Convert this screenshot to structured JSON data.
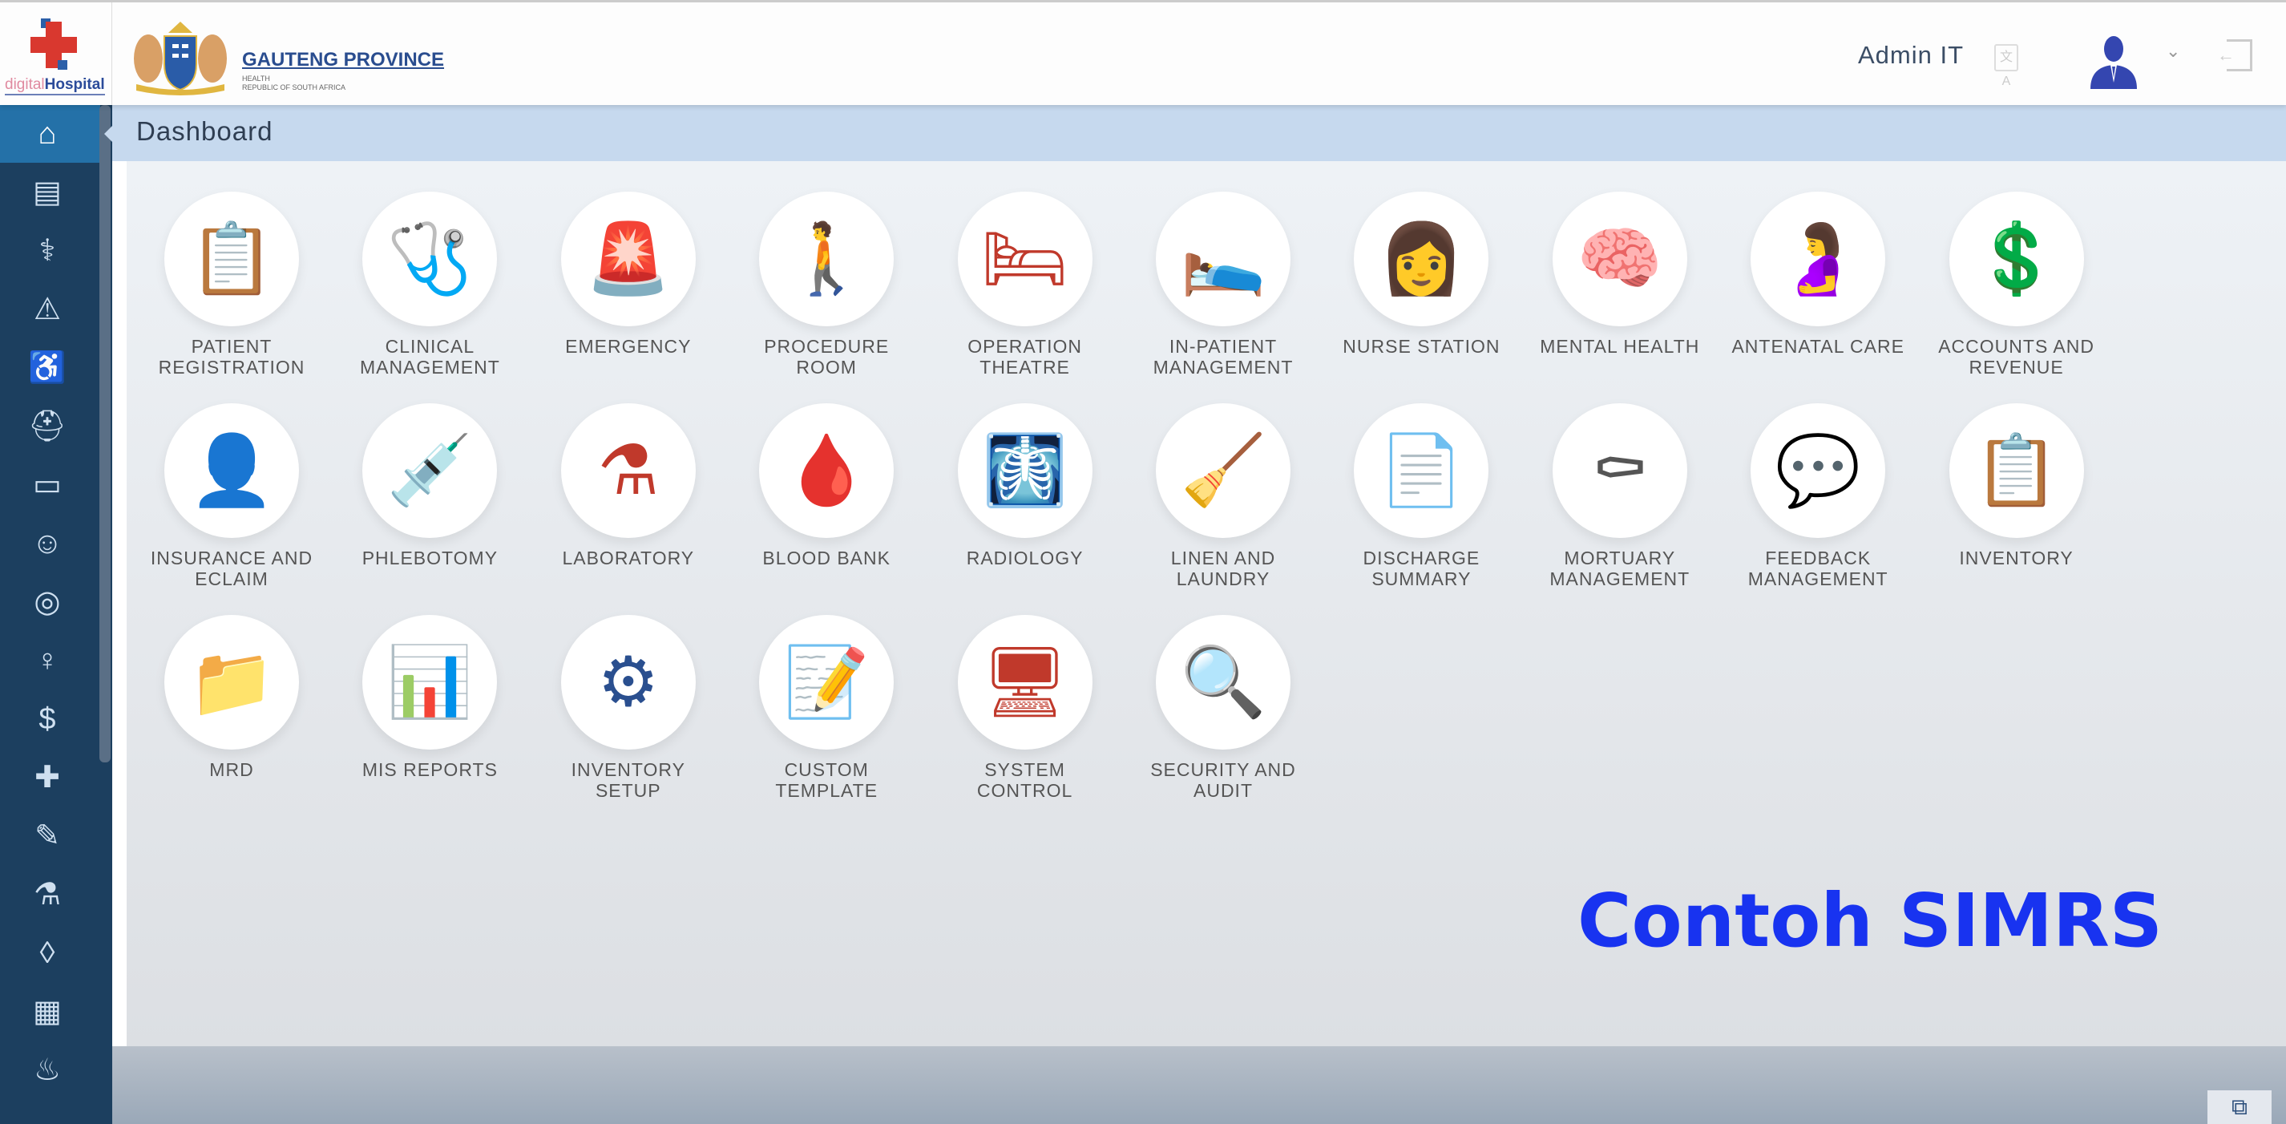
{
  "header": {
    "brand_logo": "digitalHospital",
    "province": "GAUTENG PROVINCE",
    "province_sub1": "HEALTH",
    "province_sub2": "REPUBLIC OF SOUTH AFRICA",
    "user_name": "Admin IT",
    "avatar_color": "#3446b0"
  },
  "breadcrumb": {
    "title": "Dashboard"
  },
  "sidebar": {
    "items": [
      {
        "icon": "home-icon",
        "glyph": "⌂"
      },
      {
        "icon": "clipboard-icon",
        "glyph": "▤"
      },
      {
        "icon": "clinical-icon",
        "glyph": "⚕"
      },
      {
        "icon": "siren-icon",
        "glyph": "⚠"
      },
      {
        "icon": "procedure-icon",
        "glyph": "♿"
      },
      {
        "icon": "operation-icon",
        "glyph": "⛑"
      },
      {
        "icon": "bed-icon",
        "glyph": "▭"
      },
      {
        "icon": "nurse-icon",
        "glyph": "☺"
      },
      {
        "icon": "brain-icon",
        "glyph": "◎"
      },
      {
        "icon": "antenatal-icon",
        "glyph": "♀"
      },
      {
        "icon": "accounts-icon",
        "glyph": "$"
      },
      {
        "icon": "insurance-icon",
        "glyph": "✚"
      },
      {
        "icon": "syringe-icon",
        "glyph": "✎"
      },
      {
        "icon": "flask-icon",
        "glyph": "⚗"
      },
      {
        "icon": "blood-drop-icon",
        "glyph": "◊"
      },
      {
        "icon": "radiology-icon",
        "glyph": "▦"
      },
      {
        "icon": "laundry-icon",
        "glyph": "♨"
      }
    ]
  },
  "modules": [
    {
      "label1": "PATIENT",
      "label2": "REGISTRATION",
      "icon": "clipboard-icon",
      "glyph": "📋",
      "color": "#d24a3c"
    },
    {
      "label1": "CLINICAL",
      "label2": "MANAGEMENT",
      "icon": "clinical-icon",
      "glyph": "🩺",
      "color": "#2a4f8f"
    },
    {
      "label1": "EMERGENCY",
      "label2": "",
      "icon": "siren-icon",
      "glyph": "🚨",
      "color": "#e0483a"
    },
    {
      "label1": "PROCEDURE",
      "label2": "ROOM",
      "icon": "injured-person-icon",
      "glyph": "🚶",
      "color": "#d2303f"
    },
    {
      "label1": "OPERATION",
      "label2": "THEATRE",
      "icon": "operation-icon",
      "glyph": "🛏",
      "color": "#c0392b"
    },
    {
      "label1": "IN-PATIENT",
      "label2": "MANAGEMENT",
      "icon": "hospital-bed-icon",
      "glyph": "🛌",
      "color": "#444"
    },
    {
      "label1": "NURSE STATION",
      "label2": "",
      "icon": "nurse-icon",
      "glyph": "👩",
      "color": "#2a4f8f"
    },
    {
      "label1": "MENTAL HEALTH",
      "label2": "",
      "icon": "brain-icon",
      "glyph": "🧠",
      "color": "#1e4a8a"
    },
    {
      "label1": "ANTENATAL CARE",
      "label2": "",
      "icon": "pregnant-icon",
      "glyph": "🤰",
      "color": "#3a5a8a"
    },
    {
      "label1": "ACCOUNTS AND",
      "label2": "REVENUE",
      "icon": "accounts-icon",
      "glyph": "💲",
      "color": "#d2303f"
    },
    {
      "label1": "INSURANCE AND",
      "label2": "ECLAIM",
      "icon": "insurance-icon",
      "glyph": "👤",
      "color": "#1e4a8a"
    },
    {
      "label1": "PHLEBOTOMY",
      "label2": "",
      "icon": "syringe-icon",
      "glyph": "💉",
      "color": "#d26a3c"
    },
    {
      "label1": "LABORATORY",
      "label2": "",
      "icon": "flask-icon",
      "glyph": "⚗",
      "color": "#c0392b"
    },
    {
      "label1": "BLOOD BANK",
      "label2": "",
      "icon": "blood-drop-icon",
      "glyph": "🩸",
      "color": "#d2303f"
    },
    {
      "label1": "RADIOLOGY",
      "label2": "",
      "icon": "xray-icon",
      "glyph": "🩻",
      "color": "#4aa0c8"
    },
    {
      "label1": "LINEN AND",
      "label2": "LAUNDRY",
      "icon": "laundry-icon",
      "glyph": "🧹",
      "color": "#1e4a8a"
    },
    {
      "label1": "DISCHARGE",
      "label2": "SUMMARY",
      "icon": "discharge-icon",
      "glyph": "📄",
      "color": "#2a4f8f"
    },
    {
      "label1": "MORTUARY",
      "label2": "MANAGEMENT",
      "icon": "mortuary-icon",
      "glyph": "⚰",
      "color": "#555"
    },
    {
      "label1": "FEEDBACK",
      "label2": "MANAGEMENT",
      "icon": "feedback-icon",
      "glyph": "💬",
      "color": "#1e4a8a"
    },
    {
      "label1": "INVENTORY",
      "label2": "",
      "icon": "inventory-icon",
      "glyph": "📋",
      "color": "#2a4f8f"
    },
    {
      "label1": "MRD",
      "label2": "",
      "icon": "folder-icon",
      "glyph": "📁",
      "color": "#1e4a8a"
    },
    {
      "label1": "MIS REPORTS",
      "label2": "",
      "icon": "reports-icon",
      "glyph": "📊",
      "color": "#2a4f8f"
    },
    {
      "label1": "INVENTORY",
      "label2": "SETUP",
      "icon": "inventory-setup-icon",
      "glyph": "⚙",
      "color": "#2a4f8f"
    },
    {
      "label1": "CUSTOM",
      "label2": "TEMPLATE",
      "icon": "template-icon",
      "glyph": "📝",
      "color": "#3a8ab8"
    },
    {
      "label1": "SYSTEM",
      "label2": "CONTROL",
      "icon": "system-control-icon",
      "glyph": "🖥",
      "color": "#c0392b"
    },
    {
      "label1": "SECURITY AND",
      "label2": "AUDIT",
      "icon": "security-icon",
      "glyph": "🔍",
      "color": "#2a4f8f"
    }
  ],
  "overlay": {
    "text": "Contoh SIMRS"
  }
}
